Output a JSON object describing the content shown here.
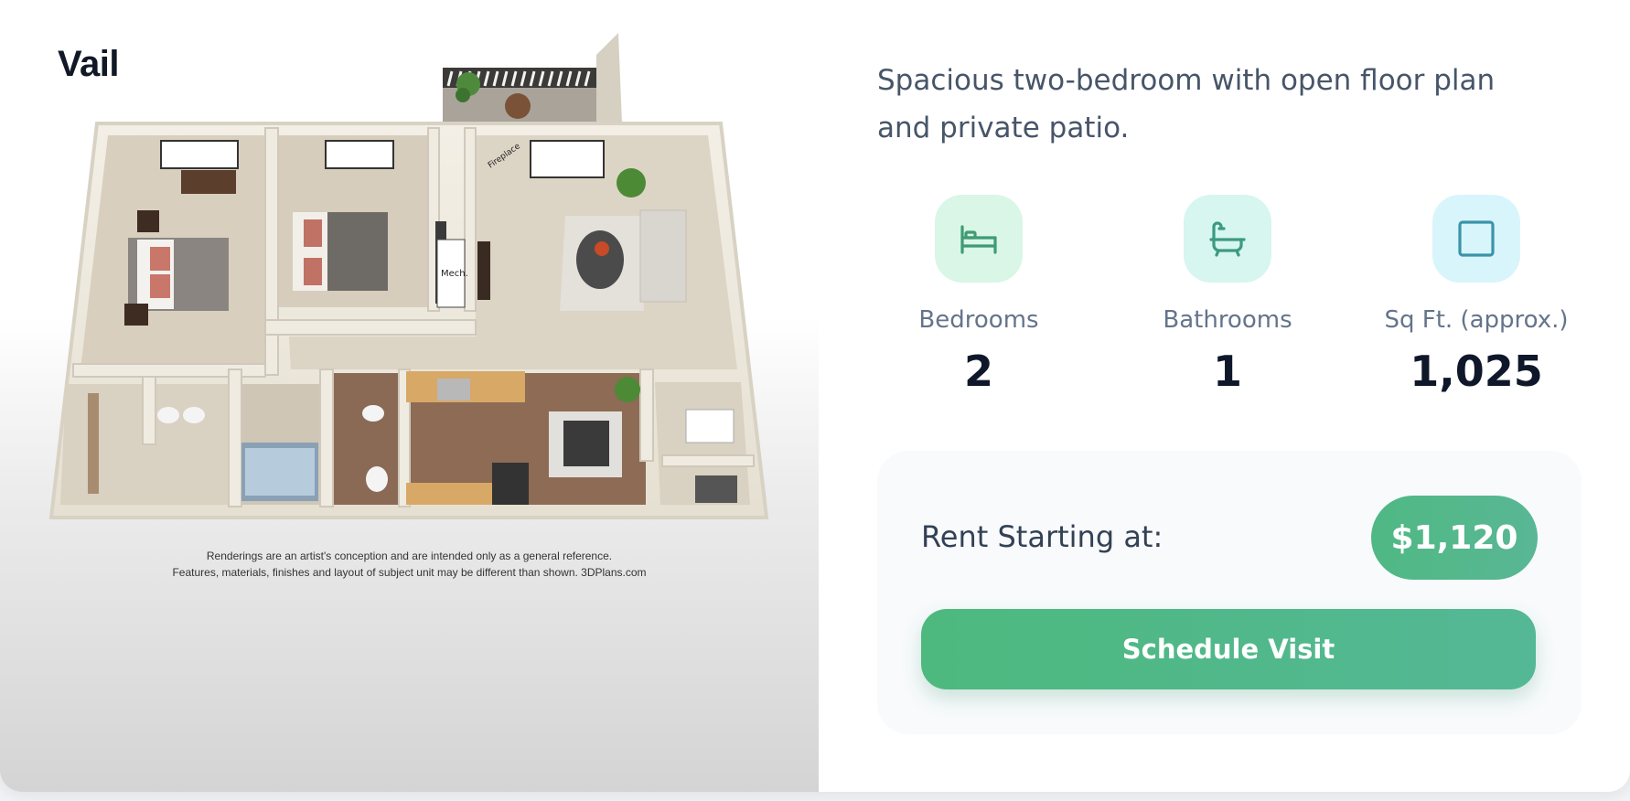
{
  "plan": {
    "name": "Vail",
    "image_labels": [
      "Fireplace",
      "Mech."
    ],
    "disclaimer_line1": "Renderings are an artist's conception and are intended only as a general reference.",
    "disclaimer_line2": "Features, materials, finishes and layout of subject unit may be different than shown. 3DPlans.com"
  },
  "description": "Spacious two-bedroom with open floor plan and private patio.",
  "stats": [
    {
      "icon": "bed-icon",
      "label": "Bedrooms",
      "value": "2",
      "bg": "#d9f6e6",
      "color": "#3f9b74"
    },
    {
      "icon": "bathtub-icon",
      "label": "Bathrooms",
      "value": "1",
      "bg": "#d6f6ef",
      "color": "#3c9a82"
    },
    {
      "icon": "square-icon",
      "label": "Sq Ft. (approx.)",
      "value": "1,025",
      "bg": "#d8f5fb",
      "color": "#3b94a8"
    }
  ],
  "pricing": {
    "label": "Rent Starting at:",
    "price": "$1,120",
    "cta_label": "Schedule Visit"
  },
  "colors": {
    "accent_start": "#4db97e",
    "accent_end": "#54b896",
    "title": "#111826",
    "text_muted": "#64748b"
  }
}
